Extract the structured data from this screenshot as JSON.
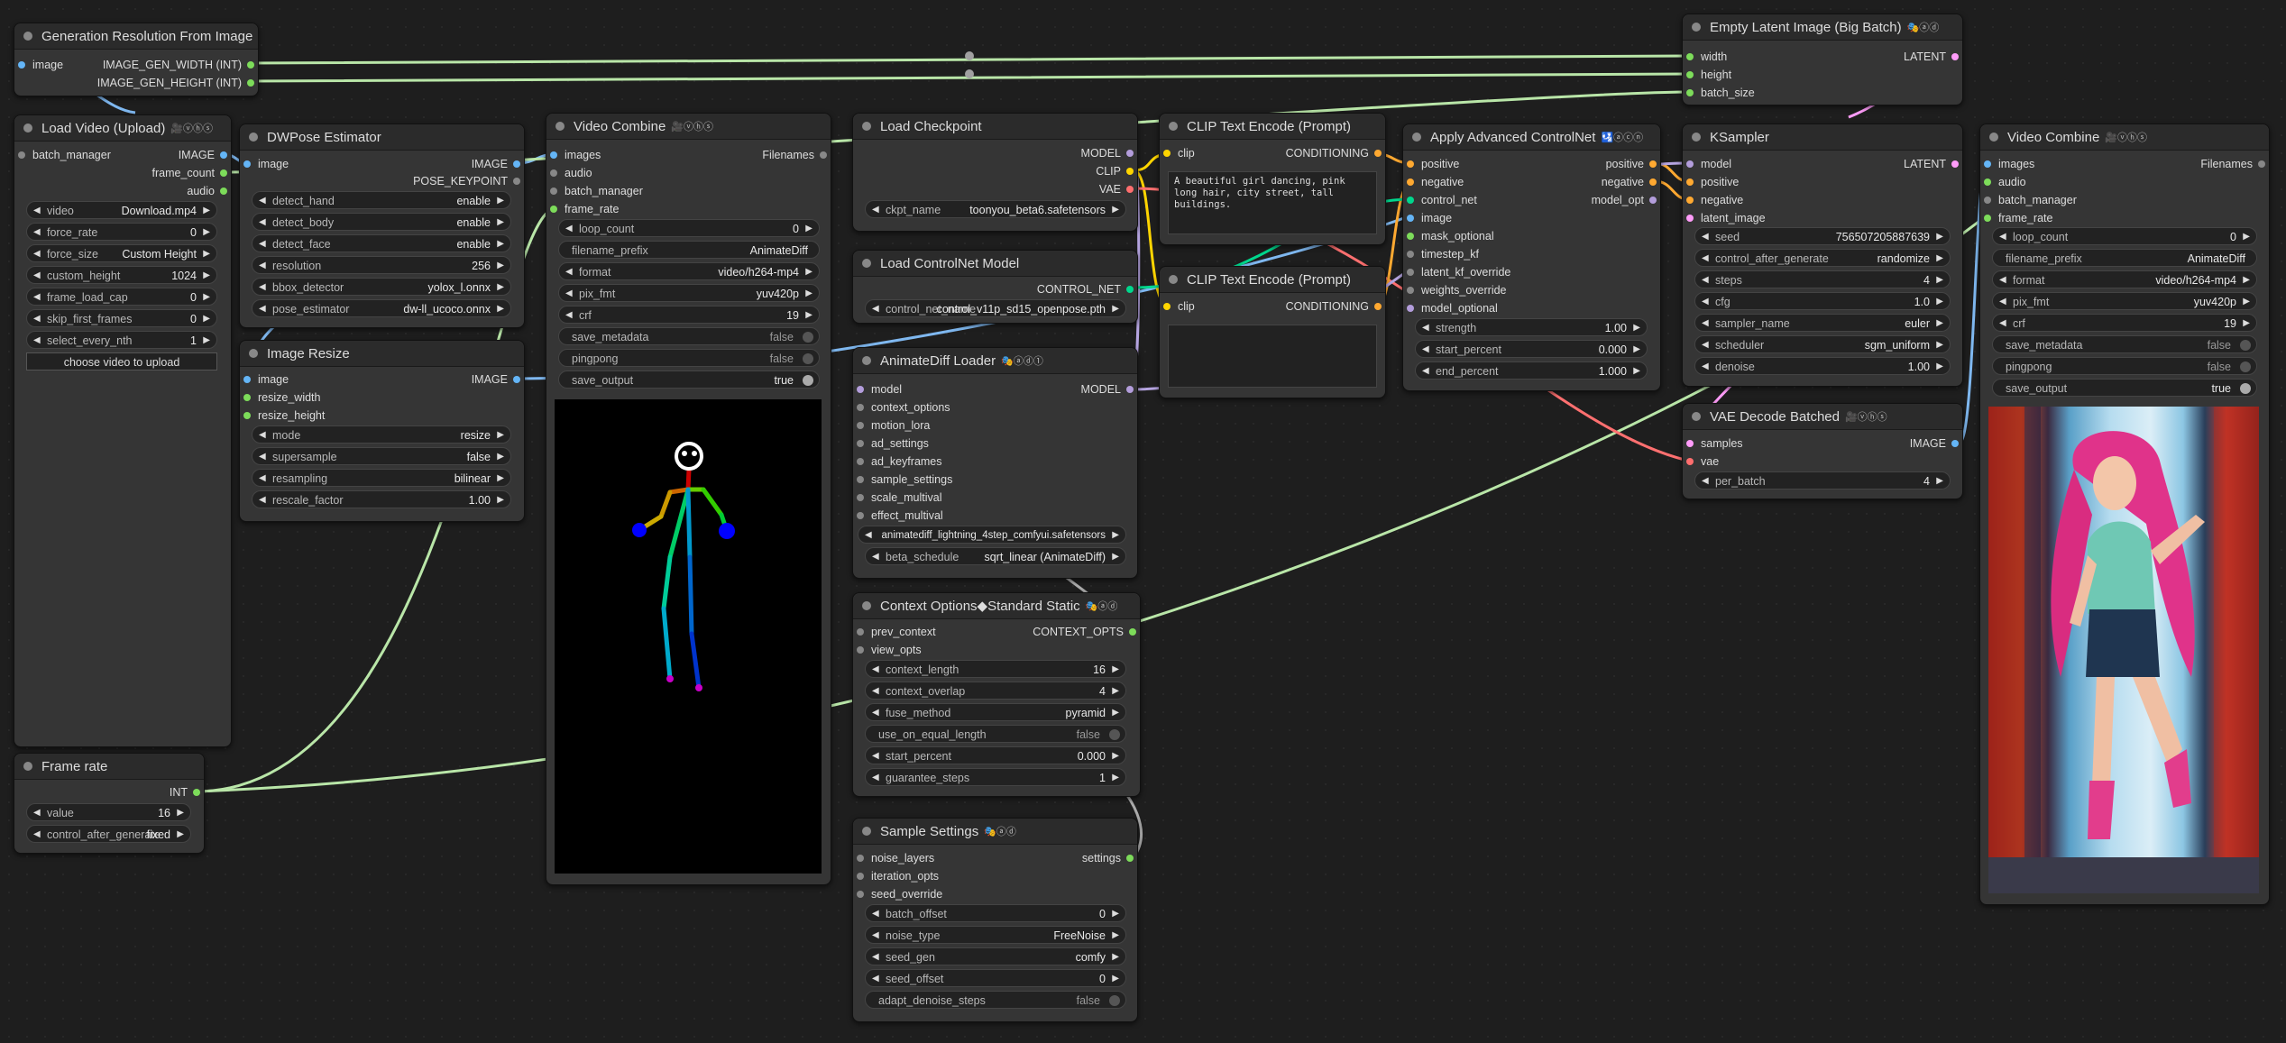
{
  "colors": {
    "image": "#64b5f6",
    "latent": "#ff9cf9",
    "model": "#b39ddb",
    "clip": "#ffd500",
    "vae": "#ff6e6e",
    "conditioning": "#ffa931",
    "int": "#7ddc5a",
    "control_net": "#00d78d",
    "generic": "#888888"
  },
  "nodes": {
    "gen_res": {
      "title": "Generation Resolution From Image",
      "in_image": "image",
      "out_w": "IMAGE_GEN_WIDTH (INT)",
      "out_h": "IMAGE_GEN_HEIGHT (INT)"
    },
    "load_video": {
      "title": "Load Video (Upload)",
      "badge": "🎥ⓥⓗⓢ",
      "in_batch": "batch_manager",
      "out_image": "IMAGE",
      "out_frames": "frame_count",
      "out_audio": "audio",
      "widgets": [
        {
          "label": "video",
          "value": "Download.mp4"
        },
        {
          "label": "force_rate",
          "value": "0"
        },
        {
          "label": "force_size",
          "value": "Custom Height"
        },
        {
          "label": "custom_height",
          "value": "1024"
        },
        {
          "label": "frame_load_cap",
          "value": "0"
        },
        {
          "label": "skip_first_frames",
          "value": "0"
        },
        {
          "label": "select_every_nth",
          "value": "1"
        }
      ],
      "upload_button": "choose video to upload"
    },
    "frame_rate": {
      "title": "Frame rate",
      "out_int": "INT",
      "widgets": [
        {
          "label": "value",
          "value": "16"
        },
        {
          "label": "control_after_generate",
          "value": "fixed"
        }
      ]
    },
    "dwpose": {
      "title": "DWPose Estimator",
      "in_image": "image",
      "out_image": "IMAGE",
      "out_pose": "POSE_KEYPOINT",
      "widgets": [
        {
          "label": "detect_hand",
          "value": "enable"
        },
        {
          "label": "detect_body",
          "value": "enable"
        },
        {
          "label": "detect_face",
          "value": "enable"
        },
        {
          "label": "resolution",
          "value": "256"
        },
        {
          "label": "bbox_detector",
          "value": "yolox_l.onnx"
        },
        {
          "label": "pose_estimator",
          "value": "dw-ll_ucoco.onnx"
        }
      ]
    },
    "image_resize": {
      "title": "Image Resize",
      "in_image": "image",
      "in_w": "resize_width",
      "in_h": "resize_height",
      "out_image": "IMAGE",
      "widgets": [
        {
          "label": "mode",
          "value": "resize"
        },
        {
          "label": "supersample",
          "value": "false"
        },
        {
          "label": "resampling",
          "value": "bilinear"
        },
        {
          "label": "rescale_factor",
          "value": "1.00"
        }
      ]
    },
    "vc1": {
      "title": "Video Combine",
      "badge": "🎥ⓥⓗⓢ",
      "in_images": "images",
      "in_audio": "audio",
      "in_batch": "batch_manager",
      "in_fr": "frame_rate",
      "out": "Filenames",
      "widgets": [
        {
          "label": "loop_count",
          "value": "0"
        },
        {
          "label": "filename_prefix",
          "value": "AnimateDiff"
        },
        {
          "label": "format",
          "value": "video/h264-mp4"
        },
        {
          "label": "pix_fmt",
          "value": "yuv420p"
        },
        {
          "label": "crf",
          "value": "19"
        }
      ],
      "toggles": [
        {
          "label": "save_metadata",
          "value": "false"
        },
        {
          "label": "pingpong",
          "value": "false"
        },
        {
          "label": "save_output",
          "value": "true"
        }
      ]
    },
    "load_ckpt": {
      "title": "Load Checkpoint",
      "out_model": "MODEL",
      "out_clip": "CLIP",
      "out_vae": "VAE",
      "widget": {
        "label": "ckpt_name",
        "value": "toonyou_beta6.safetensors"
      }
    },
    "load_cn": {
      "title": "Load ControlNet Model",
      "out": "CONTROL_NET",
      "widget": {
        "label": "control_net_name",
        "value": "control_v11p_sd15_openpose.pth"
      }
    },
    "ad_loader": {
      "title": "AnimateDiff Loader",
      "badge": "🎭ⓐⓓ①",
      "out": "MODEL",
      "inputs": [
        "model",
        "context_options",
        "motion_lora",
        "ad_settings",
        "ad_keyframes",
        "sample_settings",
        "scale_multival",
        "effect_multival"
      ],
      "widgets": [
        {
          "label": "model_name",
          "value": "animatediff_lightning_4step_comfyui.safetensors"
        },
        {
          "label": "beta_schedule",
          "value": "sqrt_linear (AnimateDiff)"
        }
      ]
    },
    "ctx": {
      "title": "Context Options◆Standard Static",
      "badge": "🎭ⓐⓓ",
      "in_prev": "prev_context",
      "in_view": "view_opts",
      "out": "CONTEXT_OPTS",
      "widgets": [
        {
          "label": "context_length",
          "value": "16"
        },
        {
          "label": "context_overlap",
          "value": "4"
        },
        {
          "label": "fuse_method",
          "value": "pyramid"
        }
      ],
      "toggle": {
        "label": "use_on_equal_length",
        "value": "false"
      },
      "widgets2": [
        {
          "label": "start_percent",
          "value": "0.000"
        },
        {
          "label": "guarantee_steps",
          "value": "1"
        }
      ]
    },
    "sample": {
      "title": "Sample Settings",
      "badge": "🎭ⓐⓓ",
      "in_noise": "noise_layers",
      "in_iter": "iteration_opts",
      "in_seed": "seed_override",
      "out": "settings",
      "widgets": [
        {
          "label": "batch_offset",
          "value": "0"
        },
        {
          "label": "noise_type",
          "value": "FreeNoise"
        },
        {
          "label": "seed_gen",
          "value": "comfy"
        },
        {
          "label": "seed_offset",
          "value": "0"
        }
      ],
      "toggle": {
        "label": "adapt_denoise_steps",
        "value": "false"
      }
    },
    "clip_pos": {
      "title": "CLIP Text Encode (Prompt)",
      "in": "clip",
      "out": "CONDITIONING",
      "text": "A beautiful girl dancing, pink long hair, city street, tall buildings."
    },
    "clip_neg": {
      "title": "CLIP Text Encode (Prompt)",
      "in": "clip",
      "out": "CONDITIONING",
      "text": ""
    },
    "acn": {
      "title": "Apply Advanced ControlNet",
      "badge": "🛂ⓐⓒⓝ",
      "inputs": [
        "positive",
        "negative",
        "control_net",
        "image",
        "mask_optional",
        "timestep_kf",
        "latent_kf_override",
        "weights_override",
        "model_optional"
      ],
      "outputs": [
        "positive",
        "negative",
        "model_opt"
      ],
      "widgets": [
        {
          "label": "strength",
          "value": "1.00"
        },
        {
          "label": "start_percent",
          "value": "0.000"
        },
        {
          "label": "end_percent",
          "value": "1.000"
        }
      ]
    },
    "latent": {
      "title": "Empty Latent Image (Big Batch)",
      "badge": "🎭ⓐⓓ",
      "inputs": [
        "width",
        "height",
        "batch_size"
      ],
      "out": "LATENT"
    },
    "ksampler": {
      "title": "KSampler",
      "inputs": [
        "model",
        "positive",
        "negative",
        "latent_image"
      ],
      "out": "LATENT",
      "widgets": [
        {
          "label": "seed",
          "value": "756507205887639"
        },
        {
          "label": "control_after_generate",
          "value": "randomize"
        },
        {
          "label": "steps",
          "value": "4"
        },
        {
          "label": "cfg",
          "value": "1.0"
        },
        {
          "label": "sampler_name",
          "value": "euler"
        },
        {
          "label": "scheduler",
          "value": "sgm_uniform"
        },
        {
          "label": "denoise",
          "value": "1.00"
        }
      ]
    },
    "vae_decode": {
      "title": "VAE Decode Batched",
      "badge": "🎥ⓥⓗⓢ",
      "in_samples": "samples",
      "in_vae": "vae",
      "out": "IMAGE",
      "widget": {
        "label": "per_batch",
        "value": "4"
      }
    },
    "vc2": {
      "title": "Video Combine",
      "badge": "🎥ⓥⓗⓢ",
      "in_images": "images",
      "in_audio": "audio",
      "in_batch": "batch_manager",
      "in_fr": "frame_rate",
      "out": "Filenames",
      "widgets": [
        {
          "label": "loop_count",
          "value": "0"
        },
        {
          "label": "filename_prefix",
          "value": "AnimateDiff"
        },
        {
          "label": "format",
          "value": "video/h264-mp4"
        },
        {
          "label": "pix_fmt",
          "value": "yuv420p"
        },
        {
          "label": "crf",
          "value": "19"
        }
      ],
      "toggles": [
        {
          "label": "save_metadata",
          "value": "false"
        },
        {
          "label": "pingpong",
          "value": "false"
        },
        {
          "label": "save_output",
          "value": "true"
        }
      ]
    }
  }
}
